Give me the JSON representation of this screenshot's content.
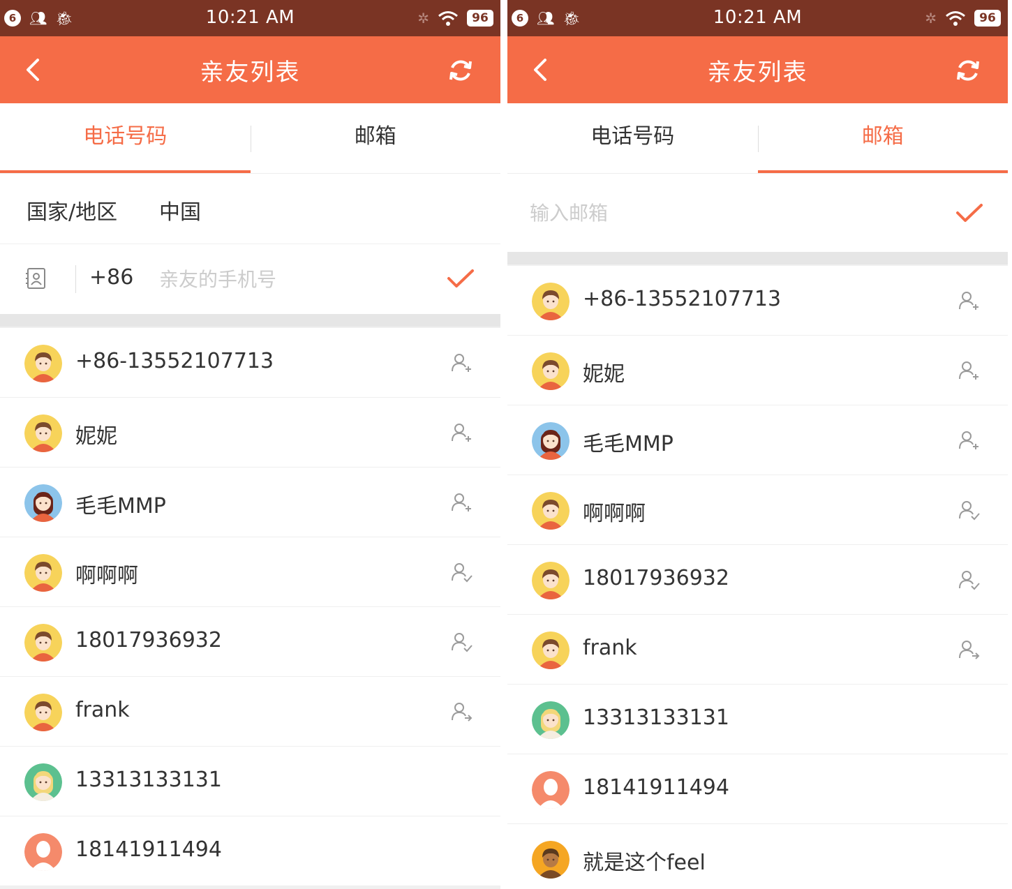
{
  "colors": {
    "accent": "#f56c47",
    "status_bar": "#7a3424",
    "text": "#333333",
    "placeholder": "#cccccc"
  },
  "status_bar": {
    "notification_count": "6",
    "time": "10:21 AM",
    "battery": "96",
    "icons": [
      "notification-badge-icon",
      "people-icon",
      "android-icon",
      "bluetooth-icon",
      "wifi-icon",
      "battery-icon"
    ]
  },
  "header": {
    "title": "亲友列表",
    "icons": [
      "back-arrow-icon",
      "refresh-icon"
    ]
  },
  "tabs": [
    {
      "label": "电话号码"
    },
    {
      "label": "邮箱"
    }
  ],
  "phone_form": {
    "region_label": "国家/地区",
    "region_value": "中国",
    "country_code": "+86",
    "phone_value": "",
    "phone_placeholder": "亲友的手机号",
    "icons": [
      "contacts-book-icon",
      "confirm-check-icon"
    ]
  },
  "email_form": {
    "email_value": "",
    "email_placeholder": "输入邮箱",
    "icons": [
      "confirm-check-icon"
    ]
  },
  "screens": [
    {
      "active_tab": "电话号码"
    },
    {
      "active_tab": "邮箱"
    }
  ],
  "left_friends": [
    {
      "name": "+86-13552107713",
      "avatar": "yellow-boy-avatar",
      "action": "add-friend-icon"
    },
    {
      "name": "妮妮",
      "avatar": "yellow-boy-avatar",
      "action": "add-friend-icon"
    },
    {
      "name": "毛毛MMP",
      "avatar": "blue-girl-avatar",
      "action": "add-friend-icon"
    },
    {
      "name": "啊啊啊",
      "avatar": "yellow-boy-avatar",
      "action": "friend-added-icon"
    },
    {
      "name": "18017936932",
      "avatar": "yellow-boy-avatar",
      "action": "friend-added-icon"
    },
    {
      "name": "frank",
      "avatar": "yellow-boy-avatar",
      "action": "invite-friend-icon"
    },
    {
      "name": "13313133131",
      "avatar": "green-blonde-avatar",
      "action": null
    },
    {
      "name": "18141911494",
      "avatar": "coral-default-avatar",
      "action": null
    }
  ],
  "right_friends": [
    {
      "name": "+86-13552107713",
      "avatar": "yellow-boy-avatar",
      "action": "add-friend-icon"
    },
    {
      "name": "妮妮",
      "avatar": "yellow-boy-avatar",
      "action": "add-friend-icon"
    },
    {
      "name": "毛毛MMP",
      "avatar": "blue-girl-avatar",
      "action": "add-friend-icon"
    },
    {
      "name": "啊啊啊",
      "avatar": "yellow-boy-avatar",
      "action": "friend-added-icon"
    },
    {
      "name": "18017936932",
      "avatar": "yellow-boy-avatar",
      "action": "friend-added-icon"
    },
    {
      "name": "frank",
      "avatar": "yellow-boy-avatar",
      "action": "invite-friend-icon"
    },
    {
      "name": "13313133131",
      "avatar": "green-blonde-avatar",
      "action": null
    },
    {
      "name": "18141911494",
      "avatar": "coral-default-avatar",
      "action": null
    },
    {
      "name": "就是这个feel",
      "avatar": "orange-mohawk-avatar",
      "action": null
    }
  ]
}
